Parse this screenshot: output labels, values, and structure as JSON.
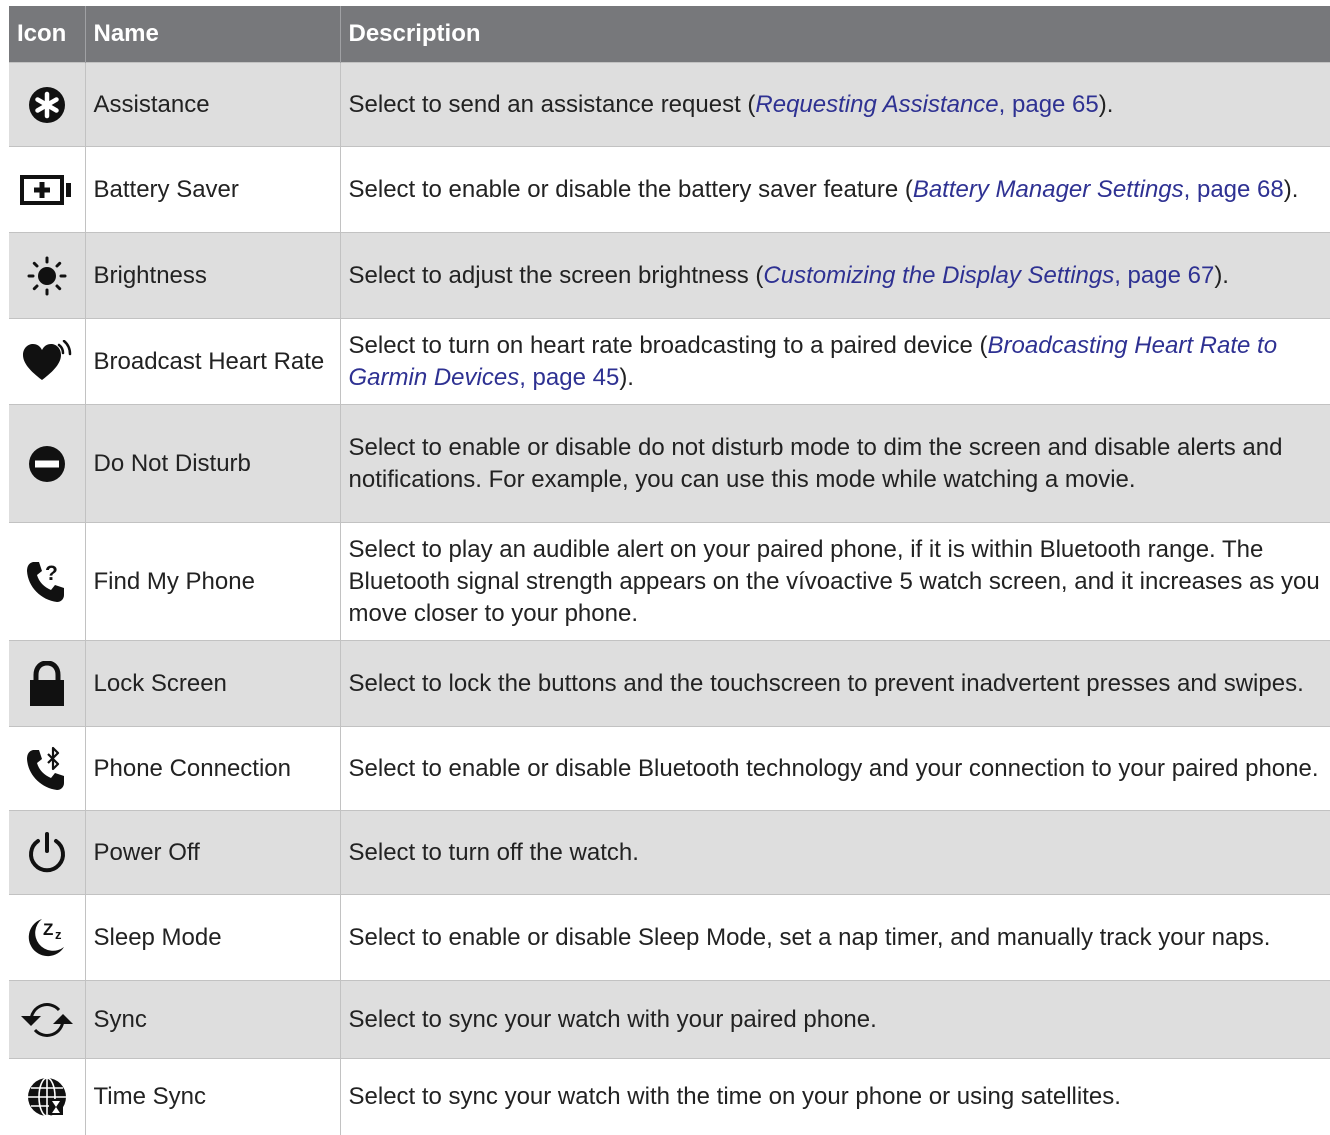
{
  "headers": {
    "icon": "Icon",
    "name": "Name",
    "description": "Description"
  },
  "rows": [
    {
      "icon": "assistance-icon",
      "name": "Assistance",
      "desc": "Select to send an assistance request (",
      "ref_title": "Requesting Assistance",
      "ref_page": ", page 65",
      "desc_end": ")."
    },
    {
      "icon": "battery-saver-icon",
      "name": "Battery Saver",
      "desc": "Select to enable or disable the battery saver feature (",
      "ref_title": "Battery Manager Settings",
      "ref_page": ", page 68",
      "desc_end": ")."
    },
    {
      "icon": "brightness-icon",
      "name": "Brightness",
      "desc": "Select to adjust the screen brightness (",
      "ref_title": "Customizing the Display Settings",
      "ref_page": ", page 67",
      "desc_end": ")."
    },
    {
      "icon": "broadcast-heart-rate-icon",
      "name": "Broadcast Heart Rate",
      "desc": "Select to turn on heart rate broadcasting to a paired device (",
      "ref_title": "Broadcasting Heart Rate to Garmin Devices",
      "ref_page": ", page 45",
      "desc_end": ")."
    },
    {
      "icon": "do-not-disturb-icon",
      "name": "Do Not Disturb",
      "desc": "Select to enable or disable do not disturb mode to dim the screen and disable alerts and notifications. For example, you can use this mode while watching a movie."
    },
    {
      "icon": "find-my-phone-icon",
      "name": "Find My Phone",
      "desc": "Select to play an audible alert on your paired phone, if it is within Bluetooth range. The Bluetooth signal strength appears on the vívoactive 5 watch screen, and it increases as you move closer to your phone."
    },
    {
      "icon": "lock-icon",
      "name": "Lock Screen",
      "desc": "Select to lock the buttons and the touchscreen to prevent inadvertent presses and swipes."
    },
    {
      "icon": "phone-connection-icon",
      "name": "Phone Connection",
      "desc": "Select to enable or disable Bluetooth technology and your connection to your paired phone."
    },
    {
      "icon": "power-icon",
      "name": "Power Off",
      "desc": "Select to turn off the watch."
    },
    {
      "icon": "sleep-mode-icon",
      "name": "Sleep Mode",
      "desc": "Select to enable or disable Sleep Mode, set a nap timer, and manually track your naps."
    },
    {
      "icon": "sync-icon",
      "name": "Sync",
      "desc": "Select to sync your watch with your paired phone."
    },
    {
      "icon": "time-sync-icon",
      "name": "Time Sync",
      "desc": "Select to sync your watch with the time on your phone or using satellites."
    }
  ]
}
